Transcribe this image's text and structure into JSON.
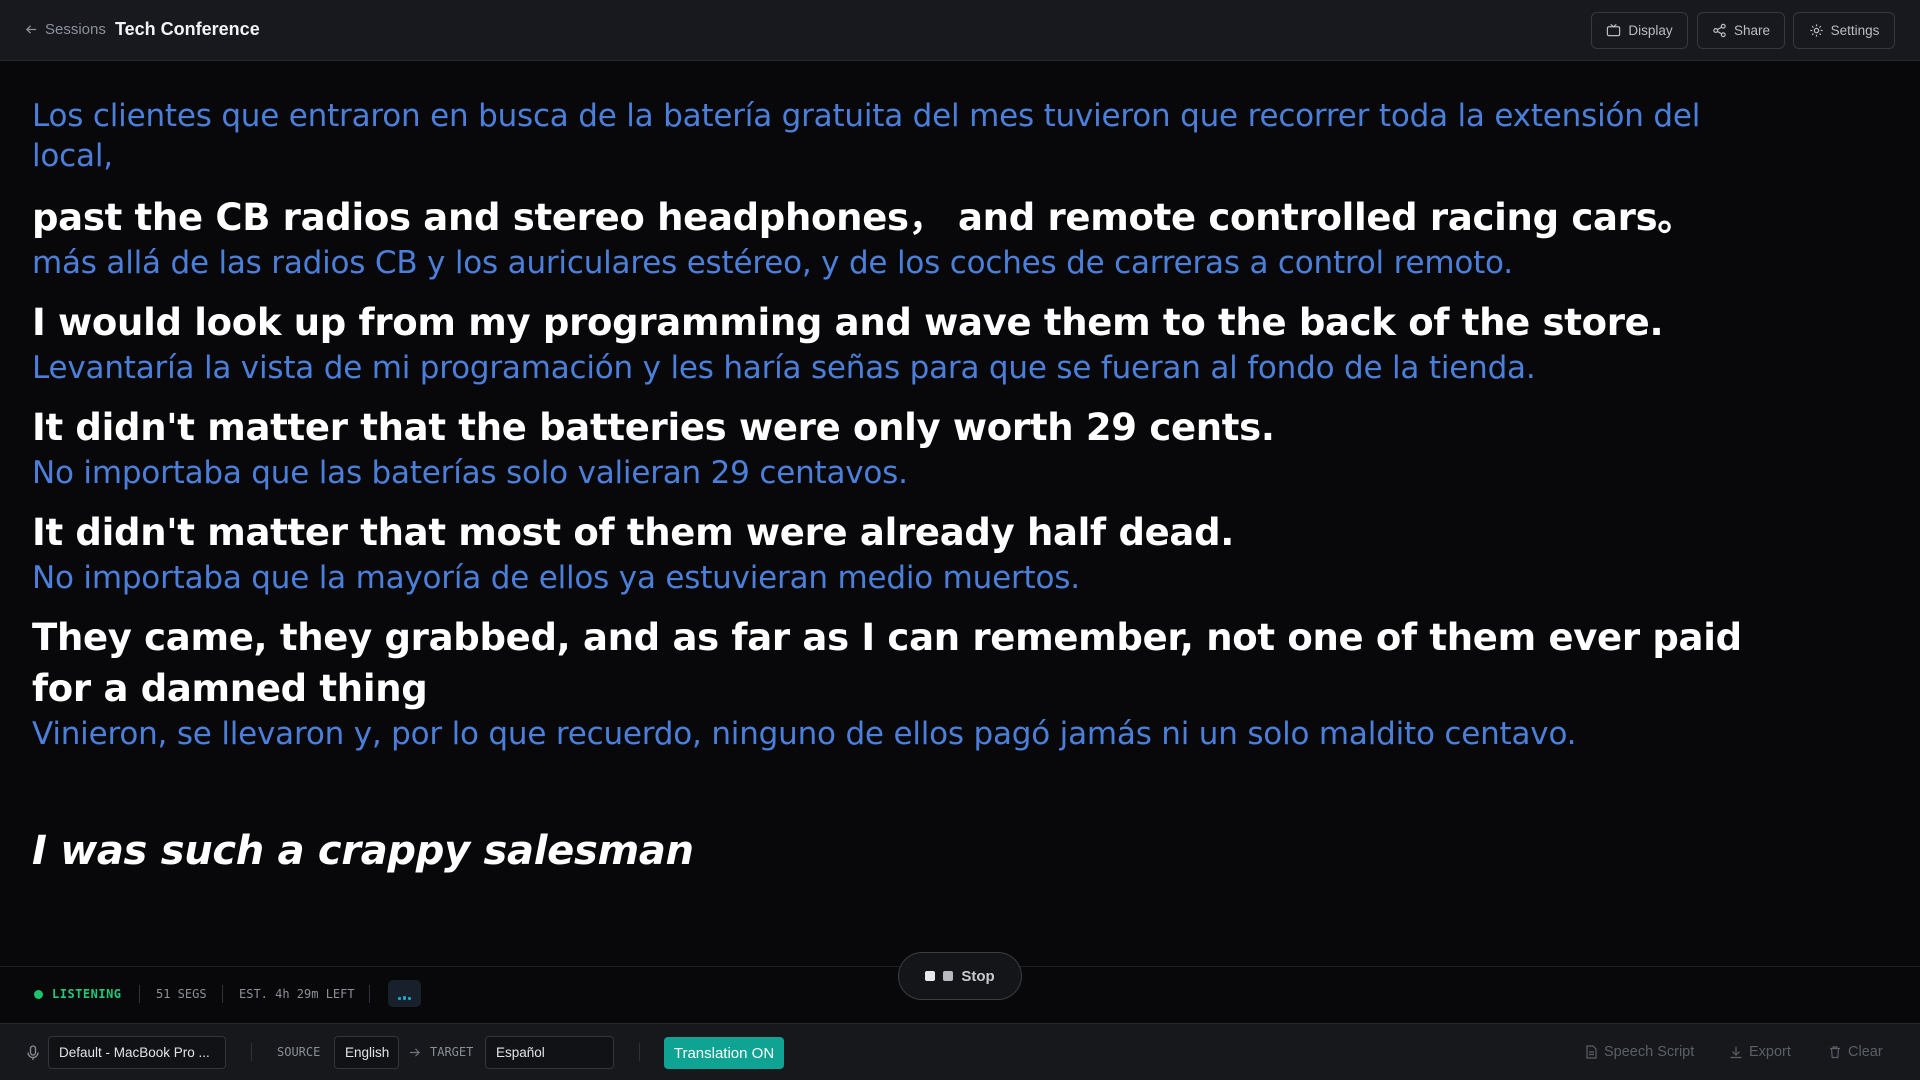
{
  "header": {
    "back_label": "Sessions",
    "title": "Tech Conference",
    "buttons": {
      "display": "Display",
      "share": "Share",
      "settings": "Settings"
    }
  },
  "transcript": {
    "first_translation": "Los clientes que entraron en busca de la batería gratuita del mes tuvieron que recorrer toda la extensión del local,",
    "segments": [
      {
        "en": "past the CB radios and stereo headphones， and remote controlled racing cars。",
        "es": "más allá de las radios CB y los auriculares estéreo, y de los coches de carreras a control remoto."
      },
      {
        "en": "I would look up from my programming and wave them to the back of the store.",
        "es": "Levantaría la vista de mi programación y les haría señas para que se fueran al fondo de la tienda."
      },
      {
        "en": "It didn't matter that the batteries were only worth 29 cents.",
        "es": "No importaba que las baterías solo valieran 29 centavos."
      },
      {
        "en": "It didn't matter that most of them were already half dead.",
        "es": "No importaba que la mayoría de ellos ya estuvieran medio muertos."
      },
      {
        "en": "They came, they grabbed, and as far as I can remember, not one of them ever paid for a damned thing",
        "es": "Vinieron, se llevaron y, por lo que recuerdo, ninguno de ellos pagó jamás ni un solo maldito centavo."
      }
    ],
    "live_text": "I was such a crappy salesman"
  },
  "status": {
    "state": "LISTENING",
    "segments": "51 SEGS",
    "estimate": "EST. 4h 29m LEFT",
    "stop_label": "Stop"
  },
  "bottom": {
    "mic_device": "Default - MacBook Pro ...",
    "source_label": "SOURCE",
    "source_value": "English",
    "target_label": "TARGET",
    "target_value": "Español",
    "translation_toggle": "Translation ON",
    "speech_script": "Speech Script",
    "export": "Export",
    "clear": "Clear"
  },
  "colors": {
    "background": "#08080a",
    "translation_text": "#4b7fd9",
    "listening": "#24c777",
    "toggle_accent": "#0fa394"
  },
  "icons": [
    "arrow-left-icon",
    "display-icon",
    "share-icon",
    "gear-icon",
    "mic-icon",
    "arrow-right-icon",
    "document-icon",
    "download-icon",
    "trash-icon",
    "stop-icon"
  ]
}
